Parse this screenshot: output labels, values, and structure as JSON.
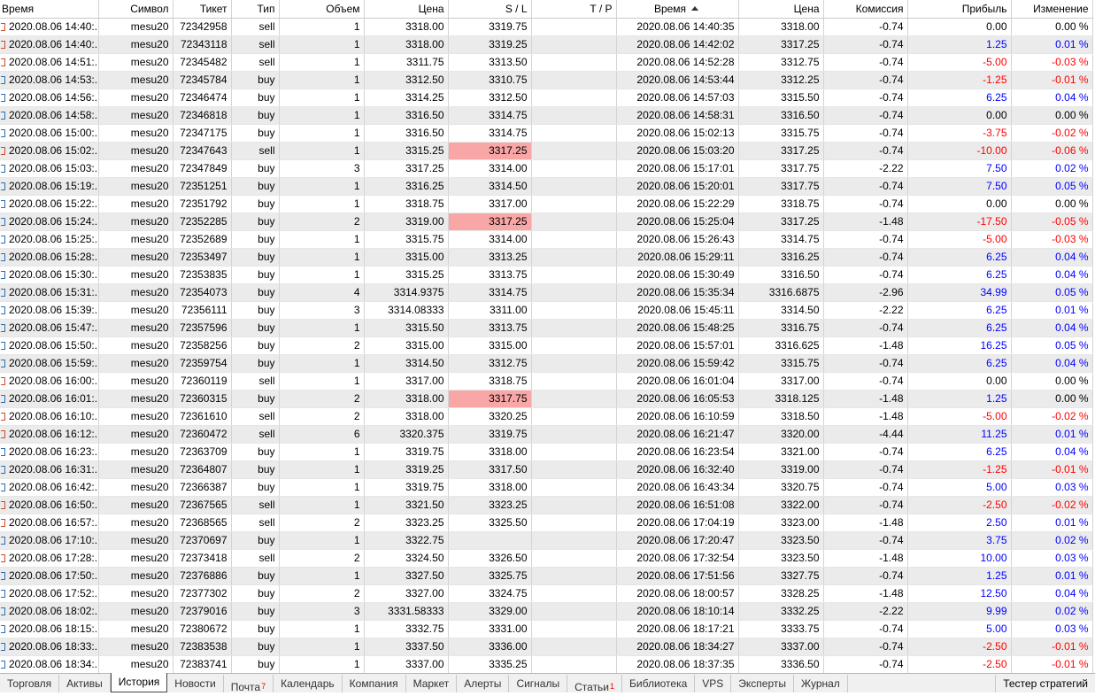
{
  "headers": {
    "open_time": "Время",
    "symbol": "Символ",
    "ticket": "Тикет",
    "type": "Тип",
    "volume": "Объем",
    "open_price": "Цена",
    "sl": "S / L",
    "tp": "T / P",
    "close_time": "Время",
    "close_price": "Цена",
    "commission": "Комиссия",
    "profit": "Прибыль",
    "change": "Изменение"
  },
  "rows": [
    [
      "2020.08.06 14:40:...",
      "mesu20",
      "72342958",
      "sell",
      "1",
      "3318.00",
      "3319.75",
      "",
      "2020.08.06 14:40:35",
      "3318.00",
      "-0.74",
      "0.00",
      "0.00 %"
    ],
    [
      "2020.08.06 14:40:...",
      "mesu20",
      "72343118",
      "sell",
      "1",
      "3318.00",
      "3319.25",
      "",
      "2020.08.06 14:42:02",
      "3317.25",
      "-0.74",
      "1.25",
      "0.01 %"
    ],
    [
      "2020.08.06 14:51:...",
      "mesu20",
      "72345482",
      "sell",
      "1",
      "3311.75",
      "3313.50",
      "",
      "2020.08.06 14:52:28",
      "3312.75",
      "-0.74",
      "-5.00",
      "-0.03 %"
    ],
    [
      "2020.08.06 14:53:...",
      "mesu20",
      "72345784",
      "buy",
      "1",
      "3312.50",
      "3310.75",
      "",
      "2020.08.06 14:53:44",
      "3312.25",
      "-0.74",
      "-1.25",
      "-0.01 %"
    ],
    [
      "2020.08.06 14:56:...",
      "mesu20",
      "72346474",
      "buy",
      "1",
      "3314.25",
      "3312.50",
      "",
      "2020.08.06 14:57:03",
      "3315.50",
      "-0.74",
      "6.25",
      "0.04 %"
    ],
    [
      "2020.08.06 14:58:...",
      "mesu20",
      "72346818",
      "buy",
      "1",
      "3316.50",
      "3314.75",
      "",
      "2020.08.06 14:58:31",
      "3316.50",
      "-0.74",
      "0.00",
      "0.00 %"
    ],
    [
      "2020.08.06 15:00:...",
      "mesu20",
      "72347175",
      "buy",
      "1",
      "3316.50",
      "3314.75",
      "",
      "2020.08.06 15:02:13",
      "3315.75",
      "-0.74",
      "-3.75",
      "-0.02 %"
    ],
    [
      "2020.08.06 15:02:...",
      "mesu20",
      "72347643",
      "sell",
      "1",
      "3315.25",
      "3317.25",
      "",
      "2020.08.06 15:03:20",
      "3317.25",
      "-0.74",
      "-10.00",
      "-0.06 %"
    ],
    [
      "2020.08.06 15:03:...",
      "mesu20",
      "72347849",
      "buy",
      "3",
      "3317.25",
      "3314.00",
      "",
      "2020.08.06 15:17:01",
      "3317.75",
      "-2.22",
      "7.50",
      "0.02 %"
    ],
    [
      "2020.08.06 15:19:...",
      "mesu20",
      "72351251",
      "buy",
      "1",
      "3316.25",
      "3314.50",
      "",
      "2020.08.06 15:20:01",
      "3317.75",
      "-0.74",
      "7.50",
      "0.05 %"
    ],
    [
      "2020.08.06 15:22:...",
      "mesu20",
      "72351792",
      "buy",
      "1",
      "3318.75",
      "3317.00",
      "",
      "2020.08.06 15:22:29",
      "3318.75",
      "-0.74",
      "0.00",
      "0.00 %"
    ],
    [
      "2020.08.06 15:24:...",
      "mesu20",
      "72352285",
      "buy",
      "2",
      "3319.00",
      "3317.25",
      "",
      "2020.08.06 15:25:04",
      "3317.25",
      "-1.48",
      "-17.50",
      "-0.05 %"
    ],
    [
      "2020.08.06 15:25:...",
      "mesu20",
      "72352689",
      "buy",
      "1",
      "3315.75",
      "3314.00",
      "",
      "2020.08.06 15:26:43",
      "3314.75",
      "-0.74",
      "-5.00",
      "-0.03 %"
    ],
    [
      "2020.08.06 15:28:...",
      "mesu20",
      "72353497",
      "buy",
      "1",
      "3315.00",
      "3313.25",
      "",
      "2020.08.06 15:29:11",
      "3316.25",
      "-0.74",
      "6.25",
      "0.04 %"
    ],
    [
      "2020.08.06 15:30:...",
      "mesu20",
      "72353835",
      "buy",
      "1",
      "3315.25",
      "3313.75",
      "",
      "2020.08.06 15:30:49",
      "3316.50",
      "-0.74",
      "6.25",
      "0.04 %"
    ],
    [
      "2020.08.06 15:31:...",
      "mesu20",
      "72354073",
      "buy",
      "4",
      "3314.9375",
      "3314.75",
      "",
      "2020.08.06 15:35:34",
      "3316.6875",
      "-2.96",
      "34.99",
      "0.05 %"
    ],
    [
      "2020.08.06 15:39:...",
      "mesu20",
      "72356111",
      "buy",
      "3",
      "3314.08333",
      "3311.00",
      "",
      "2020.08.06 15:45:11",
      "3314.50",
      "-2.22",
      "6.25",
      "0.01 %"
    ],
    [
      "2020.08.06 15:47:...",
      "mesu20",
      "72357596",
      "buy",
      "1",
      "3315.50",
      "3313.75",
      "",
      "2020.08.06 15:48:25",
      "3316.75",
      "-0.74",
      "6.25",
      "0.04 %"
    ],
    [
      "2020.08.06 15:50:...",
      "mesu20",
      "72358256",
      "buy",
      "2",
      "3315.00",
      "3315.00",
      "",
      "2020.08.06 15:57:01",
      "3316.625",
      "-1.48",
      "16.25",
      "0.05 %"
    ],
    [
      "2020.08.06 15:59:...",
      "mesu20",
      "72359754",
      "buy",
      "1",
      "3314.50",
      "3312.75",
      "",
      "2020.08.06 15:59:42",
      "3315.75",
      "-0.74",
      "6.25",
      "0.04 %"
    ],
    [
      "2020.08.06 16:00:...",
      "mesu20",
      "72360119",
      "sell",
      "1",
      "3317.00",
      "3318.75",
      "",
      "2020.08.06 16:01:04",
      "3317.00",
      "-0.74",
      "0.00",
      "0.00 %"
    ],
    [
      "2020.08.06 16:01:...",
      "mesu20",
      "72360315",
      "buy",
      "2",
      "3318.00",
      "3317.75",
      "",
      "2020.08.06 16:05:53",
      "3318.125",
      "-1.48",
      "1.25",
      "0.00 %"
    ],
    [
      "2020.08.06 16:10:...",
      "mesu20",
      "72361610",
      "sell",
      "2",
      "3318.00",
      "3320.25",
      "",
      "2020.08.06 16:10:59",
      "3318.50",
      "-1.48",
      "-5.00",
      "-0.02 %"
    ],
    [
      "2020.08.06 16:12:...",
      "mesu20",
      "72360472",
      "sell",
      "6",
      "3320.375",
      "3319.75",
      "",
      "2020.08.06 16:21:47",
      "3320.00",
      "-4.44",
      "11.25",
      "0.01 %"
    ],
    [
      "2020.08.06 16:23:...",
      "mesu20",
      "72363709",
      "buy",
      "1",
      "3319.75",
      "3318.00",
      "",
      "2020.08.06 16:23:54",
      "3321.00",
      "-0.74",
      "6.25",
      "0.04 %"
    ],
    [
      "2020.08.06 16:31:...",
      "mesu20",
      "72364807",
      "buy",
      "1",
      "3319.25",
      "3317.50",
      "",
      "2020.08.06 16:32:40",
      "3319.00",
      "-0.74",
      "-1.25",
      "-0.01 %"
    ],
    [
      "2020.08.06 16:42:...",
      "mesu20",
      "72366387",
      "buy",
      "1",
      "3319.75",
      "3318.00",
      "",
      "2020.08.06 16:43:34",
      "3320.75",
      "-0.74",
      "5.00",
      "0.03 %"
    ],
    [
      "2020.08.06 16:50:...",
      "mesu20",
      "72367565",
      "sell",
      "1",
      "3321.50",
      "3323.25",
      "",
      "2020.08.06 16:51:08",
      "3322.00",
      "-0.74",
      "-2.50",
      "-0.02 %"
    ],
    [
      "2020.08.06 16:57:...",
      "mesu20",
      "72368565",
      "sell",
      "2",
      "3323.25",
      "3325.50",
      "",
      "2020.08.06 17:04:19",
      "3323.00",
      "-1.48",
      "2.50",
      "0.01 %"
    ],
    [
      "2020.08.06 17:10:...",
      "mesu20",
      "72370697",
      "buy",
      "1",
      "3322.75",
      "",
      "",
      "2020.08.06 17:20:47",
      "3323.50",
      "-0.74",
      "3.75",
      "0.02 %"
    ],
    [
      "2020.08.06 17:28:...",
      "mesu20",
      "72373418",
      "sell",
      "2",
      "3324.50",
      "3326.50",
      "",
      "2020.08.06 17:32:54",
      "3323.50",
      "-1.48",
      "10.00",
      "0.03 %"
    ],
    [
      "2020.08.06 17:50:...",
      "mesu20",
      "72376886",
      "buy",
      "1",
      "3327.50",
      "3325.75",
      "",
      "2020.08.06 17:51:56",
      "3327.75",
      "-0.74",
      "1.25",
      "0.01 %"
    ],
    [
      "2020.08.06 17:52:...",
      "mesu20",
      "72377302",
      "buy",
      "2",
      "3327.00",
      "3324.75",
      "",
      "2020.08.06 18:00:57",
      "3328.25",
      "-1.48",
      "12.50",
      "0.04 %"
    ],
    [
      "2020.08.06 18:02:...",
      "mesu20",
      "72379016",
      "buy",
      "3",
      "3331.58333",
      "3329.00",
      "",
      "2020.08.06 18:10:14",
      "3332.25",
      "-2.22",
      "9.99",
      "0.02 %"
    ],
    [
      "2020.08.06 18:15:...",
      "mesu20",
      "72380672",
      "buy",
      "1",
      "3332.75",
      "3331.00",
      "",
      "2020.08.06 18:17:21",
      "3333.75",
      "-0.74",
      "5.00",
      "0.03 %"
    ],
    [
      "2020.08.06 18:33:...",
      "mesu20",
      "72383538",
      "buy",
      "1",
      "3337.50",
      "3336.00",
      "",
      "2020.08.06 18:34:27",
      "3337.00",
      "-0.74",
      "-2.50",
      "-0.01 %"
    ],
    [
      "2020.08.06 18:34:...",
      "mesu20",
      "72383741",
      "buy",
      "1",
      "3337.00",
      "3335.25",
      "",
      "2020.08.06 18:37:35",
      "3336.50",
      "-0.74",
      "-2.50",
      "-0.01 %"
    ]
  ],
  "sl_hit_rows": [
    7,
    11,
    21
  ],
  "tabs": [
    {
      "label": "Торговля",
      "badge": ""
    },
    {
      "label": "Активы",
      "badge": ""
    },
    {
      "label": "История",
      "badge": "",
      "active": true
    },
    {
      "label": "Новости",
      "badge": ""
    },
    {
      "label": "Почта",
      "badge": "7"
    },
    {
      "label": "Календарь",
      "badge": ""
    },
    {
      "label": "Компания",
      "badge": ""
    },
    {
      "label": "Маркет",
      "badge": ""
    },
    {
      "label": "Алерты",
      "badge": ""
    },
    {
      "label": "Сигналы",
      "badge": ""
    },
    {
      "label": "Статьи",
      "badge": "1"
    },
    {
      "label": "Библиотека",
      "badge": ""
    },
    {
      "label": "VPS",
      "badge": ""
    },
    {
      "label": "Эксперты",
      "badge": ""
    },
    {
      "label": "Журнал",
      "badge": ""
    }
  ],
  "strategy_tester": "Тестер стратегий",
  "colors": {
    "profit_positive": "#0000ff",
    "profit_negative": "#ff0000",
    "sl_hit_background": "#f8a6a6",
    "alt_row_background": "#ebebeb"
  },
  "icons": {
    "buy": "buy-position-icon",
    "sell": "sell-position-icon",
    "sort": "sort-ascending-icon"
  }
}
